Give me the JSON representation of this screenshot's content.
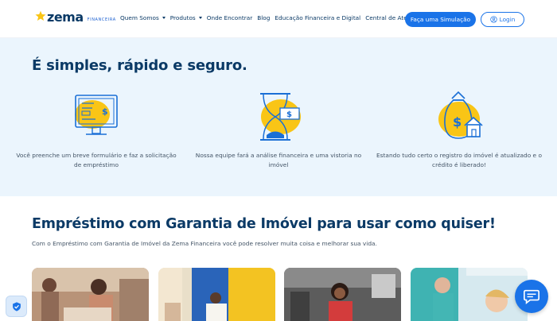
{
  "brand": {
    "name": "zema",
    "subtitle": "FINANCEIRA"
  },
  "nav": {
    "items": [
      {
        "label": "Quem Somos",
        "dropdown": true
      },
      {
        "label": "Produtos",
        "dropdown": true
      },
      {
        "label": "Onde Encontrar",
        "dropdown": false
      },
      {
        "label": "Blog",
        "dropdown": false
      },
      {
        "label": "Educação Financeira e Digital",
        "dropdown": false
      },
      {
        "label": "Central de Atendimento",
        "dropdown": false
      }
    ],
    "cta_label": "Faça uma Simulação",
    "login_label": "Login"
  },
  "steps_section": {
    "title": "É simples, rápido e seguro.",
    "steps": [
      {
        "icon": "form-computer-icon",
        "text": "Você preenche um breve formulário e faz a solicitação de empréstimo"
      },
      {
        "icon": "hourglass-money-icon",
        "text": "Nossa equipe fará a análise financeira e uma vistoria no imóvel"
      },
      {
        "icon": "money-bag-house-icon",
        "text": "Estando tudo certo o registro do imóvel é atualizado e o crédito é liberado!"
      }
    ]
  },
  "loan_section": {
    "title": "Empréstimo com Garantia de Imóvel para usar como quiser!",
    "description": "Com o Empréstimo com Garantia de Imóvel da Zema Financeira você pode resolver muita coisa e melhorar sua vida.",
    "cards": [
      {
        "image": "people-working-photo"
      },
      {
        "image": "home-renovation-photo"
      },
      {
        "image": "chef-restaurant-photo"
      },
      {
        "image": "dental-clinic-photo"
      }
    ]
  },
  "colors": {
    "primary": "#1a73e8",
    "navy": "#0b3a66",
    "yellow": "#f9c516",
    "light_bg": "#ebf5fd"
  }
}
